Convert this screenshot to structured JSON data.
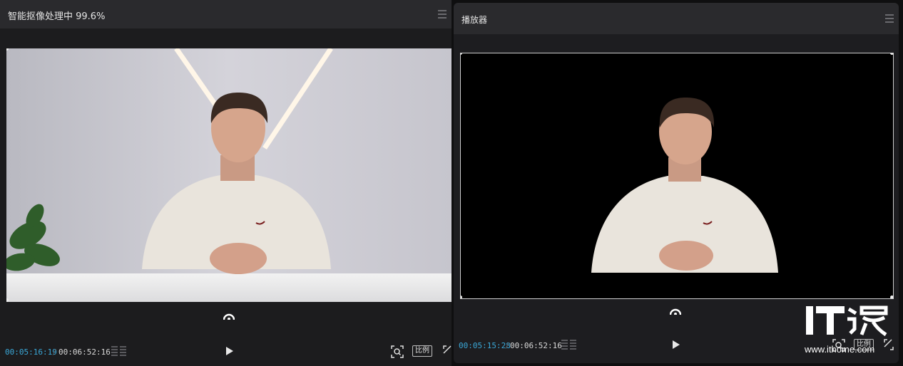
{
  "left_panel": {
    "title": "智能抠像处理中 99.6%",
    "menu_icon": "hamburger-menu-icon",
    "current_time": "00:05:16:19",
    "separator": "/",
    "total_time": "00:06:52:16",
    "ratio_label": "比例",
    "icons": [
      "anchor-icon",
      "timeline-bars-icon",
      "play-icon",
      "zoom-fit-icon",
      "fullscreen-icon"
    ]
  },
  "right_panel": {
    "title": "播放器",
    "menu_icon": "hamburger-menu-icon",
    "current_time": "00:05:15:28",
    "separator": "/",
    "total_time": "00:06:52:16",
    "ratio_label": "比例",
    "icons": [
      "anchor-icon",
      "timeline-bars-icon",
      "play-icon",
      "zoom-fit-icon",
      "fullscreen-icon"
    ]
  },
  "watermark": {
    "logo_text": "IT之家",
    "site": "www.ithome.com"
  },
  "colors": {
    "timecode_accent": "#3aa8d8",
    "panel_bg": "#1c1c1e",
    "header_bg": "#2a2a2d"
  }
}
